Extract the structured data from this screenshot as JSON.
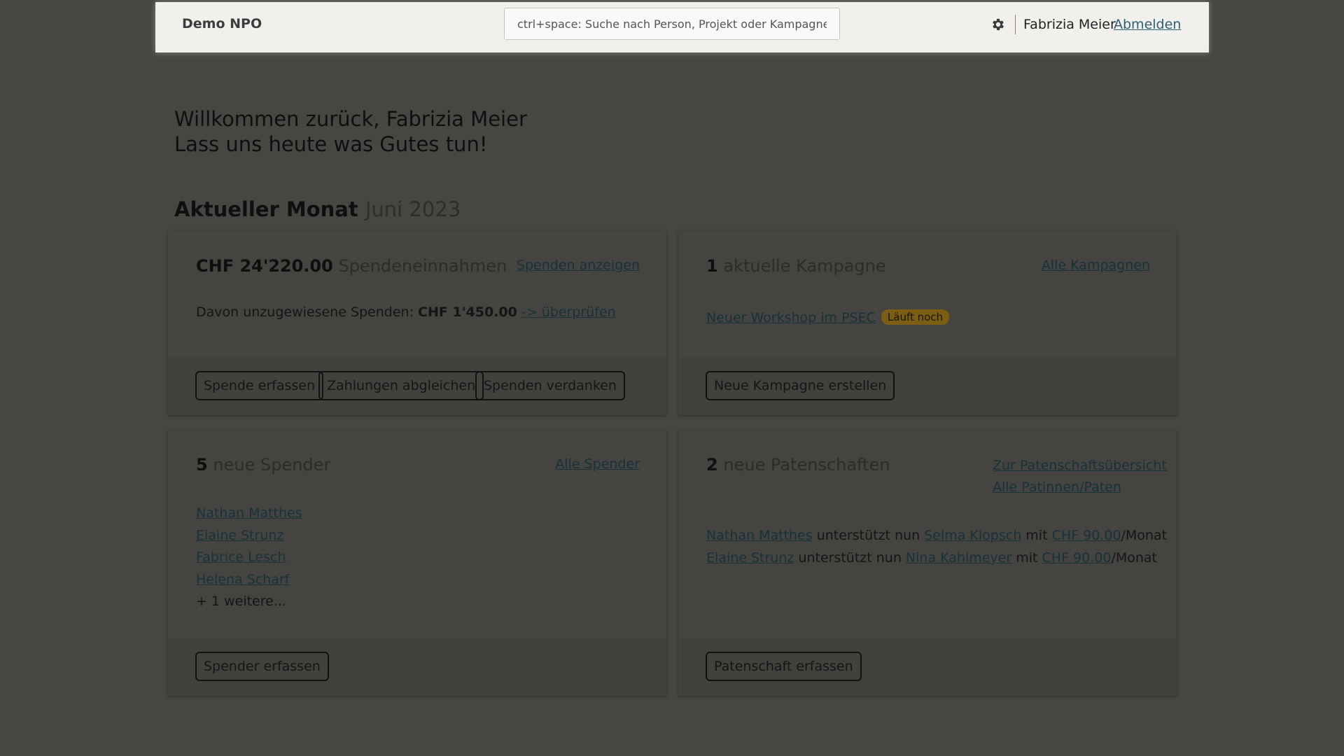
{
  "header": {
    "brand": "Demo NPO",
    "search_placeholder": "ctrl+space: Suche nach Person, Projekt oder Kampagne",
    "settings_icon": "gear-icon",
    "user_name": "Fabrizia Meier",
    "logout_label": "Abmelden"
  },
  "welcome": {
    "line1": "Willkommen zurück, Fabrizia Meier",
    "line2": "Lass uns heute was Gutes tun!"
  },
  "month": {
    "heading": "Aktueller Monat",
    "value": "Juni 2023"
  },
  "donations": {
    "amount": "CHF 24'220.00",
    "label": "Spendeneinnahmen",
    "link": "Spenden anzeigen",
    "unassigned_prefix": "Davon unzugewiesene Spenden:",
    "unassigned_amount": "CHF 1'450.00",
    "review_link": "-> überprüfen",
    "buttons": [
      "Spende erfassen",
      "Zahlungen abgleichen",
      "Spenden verdanken"
    ]
  },
  "campaigns": {
    "count": "1",
    "label": "aktuelle Kampagne",
    "link": "Alle Kampagnen",
    "items": [
      {
        "name": "Neuer Workshop im PSEC",
        "status": "Läuft noch"
      }
    ],
    "button": "Neue Kampagne erstellen"
  },
  "donors": {
    "count": "5",
    "label": "neue Spender",
    "link": "Alle Spender",
    "items": [
      "Nathan Matthes",
      "Elaine Strunz",
      "Fabrice Lesch",
      "Helena Scharf"
    ],
    "more": "+ 1 weitere...",
    "button": "Spender erfassen"
  },
  "sponsorships": {
    "count": "2",
    "label": "neue Patenschaften",
    "link_overview": "Zur Patenschaftsübersicht",
    "link_sponsors": "Alle Patinnen/Paten",
    "supports_text": "unterstützt nun",
    "with_text": "mit",
    "per_month": "/Monat",
    "items": [
      {
        "sponsor": "Nathan Matthes",
        "child": "Selma Klopsch",
        "amount": "CHF 90.00"
      },
      {
        "sponsor": "Elaine Strunz",
        "child": "Nina Kahlmeyer",
        "amount": "CHF 90.00"
      }
    ],
    "button": "Patenschaft erfassen"
  }
}
